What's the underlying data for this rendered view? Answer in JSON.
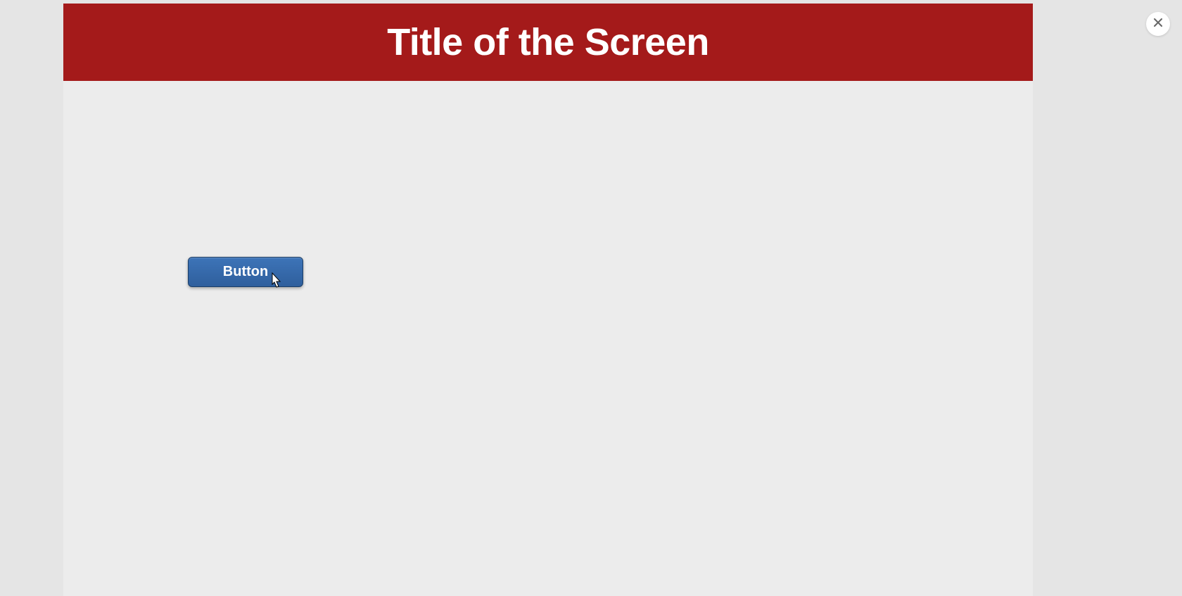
{
  "header": {
    "title": "Title of the Screen"
  },
  "content": {
    "button_label": "Button"
  },
  "colors": {
    "header_bg": "#a41a1a",
    "button_bg": "#2f5f9d",
    "page_bg": "#e5e5e5"
  }
}
